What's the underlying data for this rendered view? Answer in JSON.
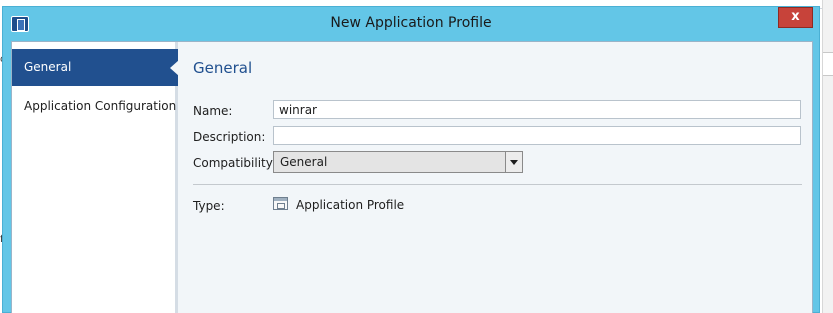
{
  "window": {
    "title": "New Application Profile",
    "close_label": "x"
  },
  "nav": {
    "items": [
      {
        "label": "General",
        "selected": true
      },
      {
        "label": "Application Configuration",
        "selected": false
      }
    ]
  },
  "main": {
    "section_title": "General",
    "name_label": "Name:",
    "name_value": "winrar",
    "description_label": "Description:",
    "description_value": "",
    "compatibility_label": "Compatibility:",
    "compatibility_value": "General",
    "type_label": "Type:",
    "type_value": "Application Profile",
    "type_icon": "application-profile-icon"
  },
  "background": {
    "frag_o": "o",
    "frag_f": "f"
  },
  "colors": {
    "titlebar": "#63c6e7",
    "nav_selected": "#21508f",
    "close_button": "#c7433a",
    "section_title": "#21508f"
  }
}
